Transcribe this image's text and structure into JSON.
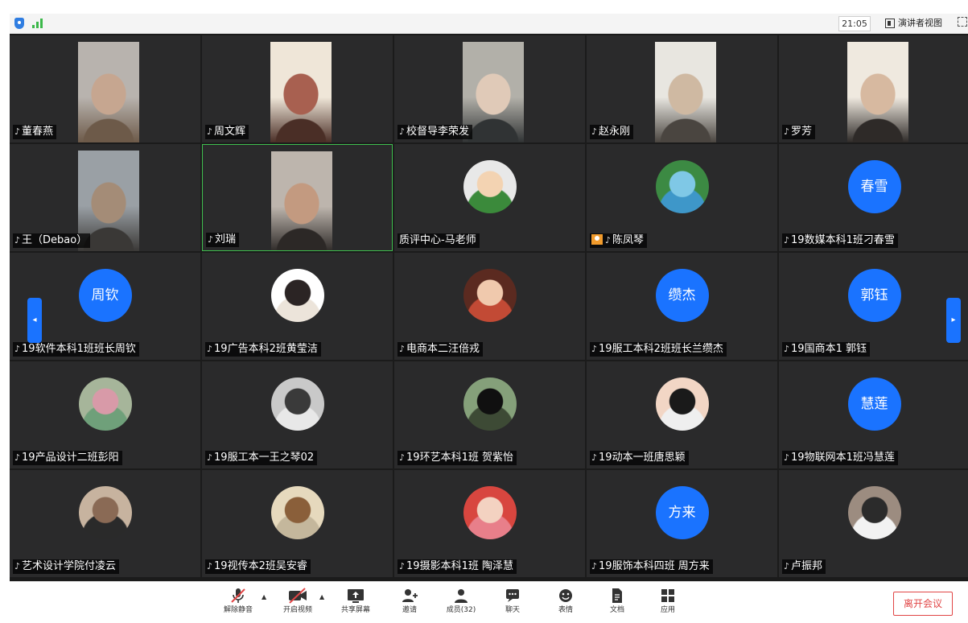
{
  "topbar": {
    "time": "21:05",
    "view_label": "演讲者视图"
  },
  "participants": [
    {
      "name": "董春燕",
      "kind": "video",
      "colors": [
        "#6d5a49",
        "#c6a690",
        "#b8b3ae"
      ]
    },
    {
      "name": "周文辉",
      "kind": "video",
      "colors": [
        "#4a2e26",
        "#a86050",
        "#efe6d8"
      ]
    },
    {
      "name": "校督导李荣发",
      "kind": "video",
      "colors": [
        "#303334",
        "#e0cab8",
        "#b2b0a9"
      ]
    },
    {
      "name": "赵永刚",
      "kind": "video",
      "colors": [
        "#4a4540",
        "#cfb9a2",
        "#e8e6e0"
      ]
    },
    {
      "name": "罗芳",
      "kind": "video",
      "colors": [
        "#2e2a28",
        "#d7b9a0",
        "#efe9df"
      ]
    },
    {
      "name": "王（Debao）",
      "kind": "video",
      "colors": [
        "#3a3836",
        "#a48c77",
        "#9aa0a5"
      ]
    },
    {
      "name": "刘瑞",
      "kind": "video",
      "colors": [
        "#2c2826",
        "#c39a80",
        "#bdb5ad"
      ]
    },
    {
      "name": "质评中心-马老师",
      "kind": "avatar",
      "colors": [
        "#3b8a3b",
        "#f3d3b2",
        "#e8e8e8"
      ],
      "badge": false,
      "mic": false
    },
    {
      "name": "陈凤琴",
      "kind": "avatar",
      "colors": [
        "#3e97c9",
        "#7fc8e6",
        "#3c8a43"
      ],
      "badge": true
    },
    {
      "name": "19数媒本科1班刁春雪",
      "kind": "text",
      "initials": "春雪"
    },
    {
      "name": "19软件本科1班班长周钦",
      "kind": "text",
      "initials": "周钦"
    },
    {
      "name": "19广告本科2班黄莹洁",
      "kind": "avatar",
      "colors": [
        "#ece4da",
        "#2b2424",
        "#ffffff"
      ]
    },
    {
      "name": "电商本二汪倍戎",
      "kind": "avatar",
      "colors": [
        "#c24a35",
        "#f0c9ad",
        "#5b2a20"
      ]
    },
    {
      "name": "19服工本科2班班长兰缵杰",
      "kind": "text",
      "initials": "缵杰"
    },
    {
      "name": "19国商本1  郭钰",
      "kind": "text",
      "initials": "郭钰"
    },
    {
      "name": "19产品设计二班彭阳",
      "kind": "avatar",
      "colors": [
        "#6fa07a",
        "#d89aa8",
        "#a6b59a"
      ]
    },
    {
      "name": "19服工本一王之琴02",
      "kind": "avatar",
      "colors": [
        "#e8e8e8",
        "#3a3a3a",
        "#c9c9c9"
      ]
    },
    {
      "name": "19环艺本科1班 贺紫怡",
      "kind": "avatar",
      "colors": [
        "#3d4a35",
        "#101010",
        "#85a07a"
      ]
    },
    {
      "name": "19动本一班唐思颖",
      "kind": "avatar",
      "colors": [
        "#efefef",
        "#1a1a1a",
        "#f2d6c5"
      ]
    },
    {
      "name": "19物联网本1班冯慧莲",
      "kind": "text",
      "initials": "慧莲"
    },
    {
      "name": "艺术设计学院付凌云",
      "kind": "avatar",
      "colors": [
        "#2a2a2a",
        "#8a6a55",
        "#c7b39f"
      ]
    },
    {
      "name": "19视传本2班吴安睿",
      "kind": "avatar",
      "colors": [
        "#c4b79c",
        "#8a5f3a",
        "#e6d9bd"
      ]
    },
    {
      "name": "19摄影本科1班 陶泽慧",
      "kind": "avatar",
      "colors": [
        "#e87f8a",
        "#f3d2c1",
        "#d8463f"
      ]
    },
    {
      "name": "19服饰本科四班  周方来",
      "kind": "text",
      "initials": "方来"
    },
    {
      "name": "卢振邦",
      "kind": "avatar",
      "colors": [
        "#f2f2f2",
        "#2b2b2b",
        "#9c8c80"
      ]
    }
  ],
  "toolbar": {
    "items": [
      {
        "id": "unmute",
        "label": "解除静音",
        "icon": "mic-muted-icon"
      },
      {
        "id": "video",
        "label": "开启视频",
        "icon": "video-off-icon"
      },
      {
        "id": "share",
        "label": "共享屏幕",
        "icon": "share-screen-icon"
      },
      {
        "id": "invite",
        "label": "邀请",
        "icon": "invite-icon"
      },
      {
        "id": "members",
        "label": "成员(32)",
        "icon": "members-icon"
      },
      {
        "id": "chat",
        "label": "聊天",
        "icon": "chat-icon"
      },
      {
        "id": "reactions",
        "label": "表情",
        "icon": "smiley-icon"
      },
      {
        "id": "docs",
        "label": "文档",
        "icon": "document-icon"
      },
      {
        "id": "apps",
        "label": "应用",
        "icon": "apps-icon"
      }
    ],
    "leave_label": "离开会议"
  },
  "colors": {
    "tile_bg": "#2a2a2b",
    "accent_blue": "#1a73ff",
    "leave_red": "#e14545",
    "active_green": "#3fbf4f"
  }
}
